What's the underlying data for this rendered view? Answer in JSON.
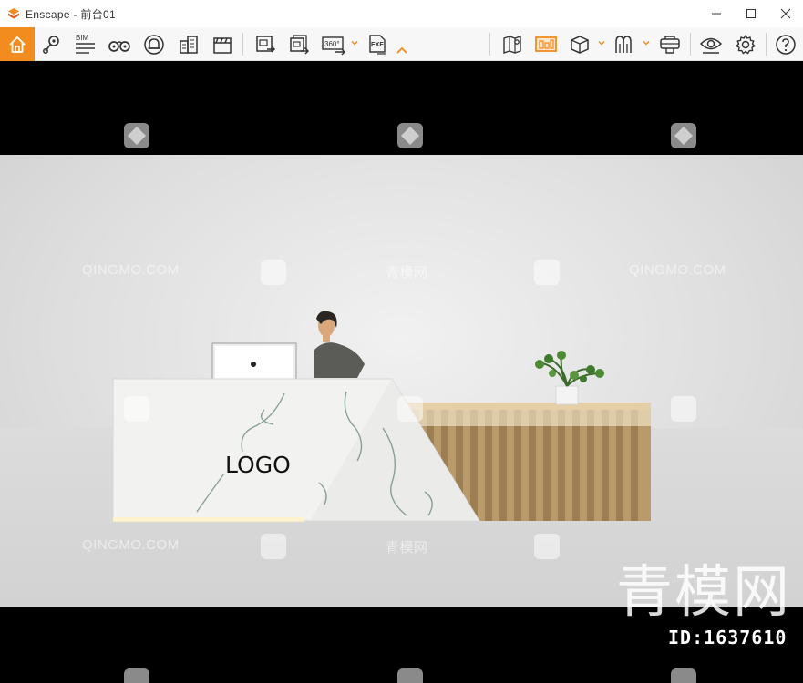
{
  "window": {
    "app_name": "Enscape",
    "separator": " - ",
    "document": "前台01",
    "controls": [
      "minimize-icon",
      "maximize-icon",
      "close-icon"
    ]
  },
  "toolbar": {
    "accent": "#f28c1e",
    "bim_label": "BIM",
    "panorama_label": "360°",
    "exe_label": "EXE",
    "left_icons": [
      "home-icon",
      "location-pin-icon",
      "bim-icon",
      "binoculars-icon",
      "bell-icon",
      "buildings-icon",
      "clapperboard-icon"
    ],
    "export_icons": [
      "screenshot-export-icon",
      "batch-export-icon",
      "panorama-export-icon",
      "exe-export-icon",
      "collapse-chevron-icon"
    ],
    "right_icons": [
      "map-icon",
      "visual-settings-icon",
      "cube-icon",
      "asset-library-icon",
      "vr-headset-icon",
      "eye-settings-icon",
      "gear-icon",
      "help-icon"
    ]
  },
  "viewport": {
    "desk_logo": "LOGO",
    "watermark_text": "QINGMO.COM",
    "watermark_cn": "青模网",
    "watermark_big": "青模网",
    "id_label": "ID:1637610"
  }
}
